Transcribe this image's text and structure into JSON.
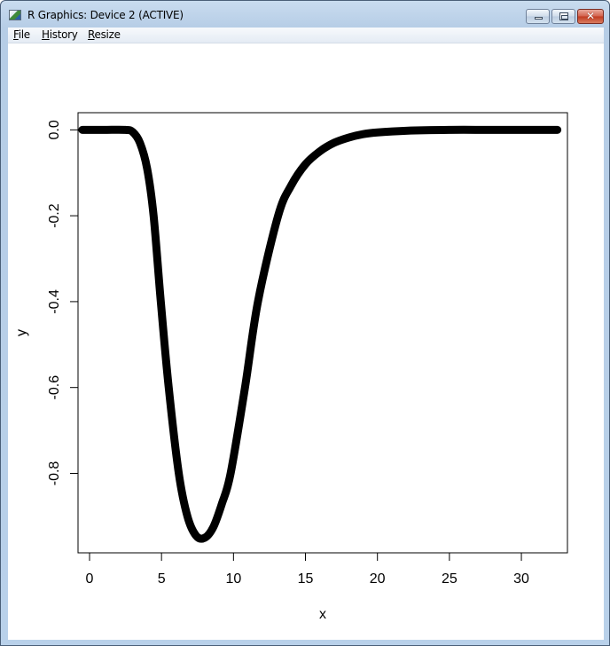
{
  "window": {
    "title": "R Graphics: Device 2 (ACTIVE)",
    "controls": {
      "minimize": "minimize",
      "maximize": "maximize",
      "close": "✕"
    }
  },
  "menu": {
    "items": [
      {
        "label": "File",
        "accel": "F",
        "rest": "ile"
      },
      {
        "label": "History",
        "accel": "H",
        "rest": "istory"
      },
      {
        "label": "Resize",
        "accel": "R",
        "rest": "esize"
      }
    ]
  },
  "chart_data": {
    "type": "line",
    "title": "",
    "xlabel": "x",
    "ylabel": "y",
    "xlim": [
      -0.8,
      33.2
    ],
    "ylim": [
      -0.985,
      0.04
    ],
    "xticks": [
      0,
      5,
      10,
      15,
      20,
      25,
      30
    ],
    "xtick_labels": [
      "0",
      "5",
      "10",
      "15",
      "20",
      "25",
      "30"
    ],
    "yticks": [
      0.0,
      -0.2,
      -0.4,
      -0.6,
      -0.8
    ],
    "ytick_labels": [
      "0.0",
      "-0.2",
      "-0.4",
      "-0.6",
      "-0.8"
    ],
    "grid": false,
    "legend": "none",
    "line_color": "#000000",
    "series": [
      {
        "name": "y",
        "x": [
          -0.5,
          1.0,
          2.5,
          3.0,
          3.5,
          4.0,
          4.45,
          4.95,
          5.5,
          6.2,
          6.8,
          7.4,
          8.0,
          8.6,
          9.2,
          9.8,
          10.8,
          11.7,
          13.1,
          14.0,
          15.0,
          16.0,
          17.0,
          18.0,
          19.0,
          20.0,
          22.0,
          25.0,
          28.0,
          32.5
        ],
        "y": [
          0.0,
          0.0,
          0.0,
          -0.005,
          -0.03,
          -0.09,
          -0.2,
          -0.4,
          -0.6,
          -0.8,
          -0.9,
          -0.945,
          -0.95,
          -0.925,
          -0.87,
          -0.8,
          -0.6,
          -0.4,
          -0.2,
          -0.13,
          -0.08,
          -0.05,
          -0.03,
          -0.018,
          -0.01,
          -0.006,
          -0.002,
          0.0,
          0.0,
          0.0
        ]
      }
    ]
  }
}
